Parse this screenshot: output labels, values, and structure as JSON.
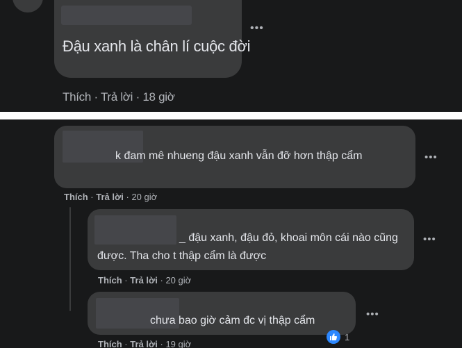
{
  "top_comment": {
    "text": "Đậu xanh là chân lí cuộc đời",
    "more_label": "•••",
    "actions": {
      "like": "Thích",
      "sep": " · ",
      "reply": "Trả lời",
      "sep2": " · ",
      "time": "18 giờ"
    }
  },
  "comments": [
    {
      "text": "k đam mê nhueng đậu xanh vẫn đỡ hơn thập cẩm",
      "more_label": "•••",
      "actions": {
        "like": "Thích",
        "reply": "Trả lời",
        "time": "20 giờ"
      }
    },
    {
      "text": "_ đậu xanh, đậu đỏ, khoai môn cái nào cũng được. Tha cho t thập cẩm là được",
      "more_label": "•••",
      "actions": {
        "like": "Thích",
        "reply": "Trả lời",
        "time": "20 giờ"
      }
    },
    {
      "text": "chưa bao giờ cảm đc vị thập cẩm",
      "more_label": "•••",
      "reactions": {
        "icon": "like-icon",
        "count": "1"
      },
      "actions": {
        "like": "Thích",
        "reply": "Trả lời",
        "time": "19 giờ"
      }
    }
  ],
  "colors": {
    "background": "#18191a",
    "bubble": "#3a3b3c",
    "text": "#e4e6eb",
    "muted": "#b0b3b8",
    "like_blue": "#2d88ff"
  }
}
